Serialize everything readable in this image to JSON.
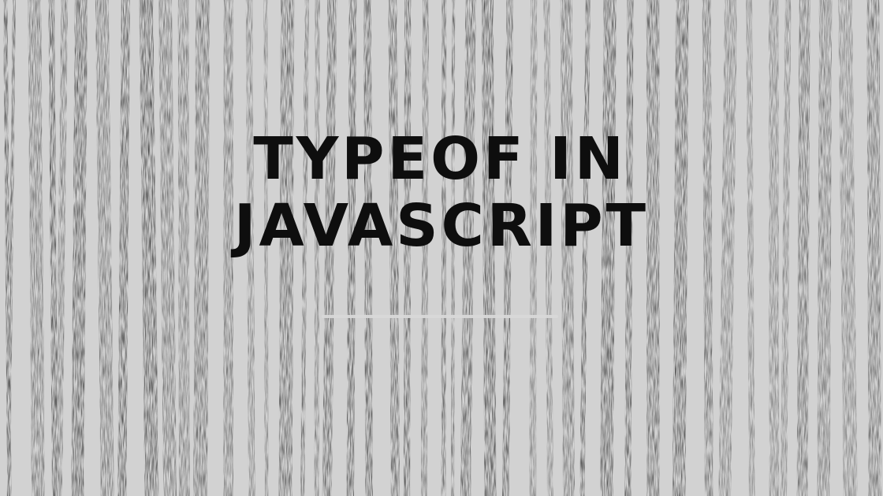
{
  "title": {
    "line1": "TYPEOF IN",
    "line2": "JAVASCRIPT"
  },
  "colors": {
    "background": "#d2d2d2",
    "stroke": "#1a1a1a",
    "title_text": "#0e0e0e",
    "underline": "#d8d8d8"
  }
}
